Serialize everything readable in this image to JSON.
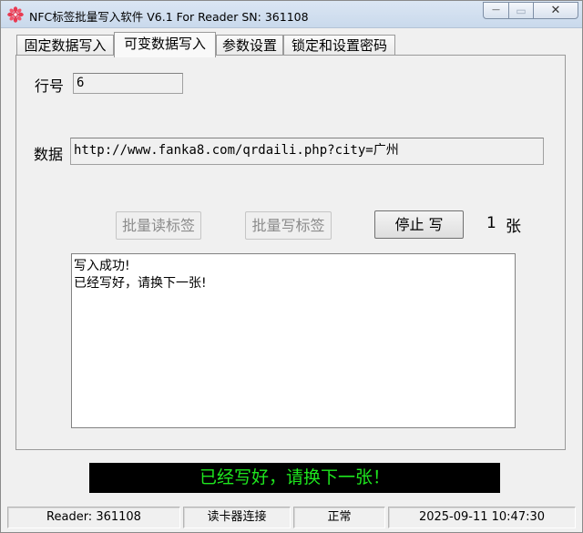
{
  "window": {
    "title": "NFC标签批量写入软件 V6.1 For Reader  SN:  361108",
    "app_icon": "gear-flower-icon",
    "controls": {
      "minimize": "—",
      "maximize": "▭",
      "close": "✕"
    }
  },
  "tabs": [
    {
      "label": "固定数据写入",
      "active": false
    },
    {
      "label": "可变数据写入",
      "active": true
    },
    {
      "label": "参数设置",
      "active": false
    },
    {
      "label": "锁定和设置密码",
      "active": false
    }
  ],
  "form": {
    "row_label": "行号",
    "row_value": "6",
    "data_label": "数据",
    "data_value": "http://www.fanka8.com/qrdaili.php?city=广州"
  },
  "buttons": {
    "batch_read": "批量读标签",
    "batch_write": "批量写标签",
    "stop_write": "停止 写"
  },
  "counter": {
    "value": "1",
    "unit": "张"
  },
  "log": {
    "lines": [
      "写入成功!",
      "已经写好，请换下一张!"
    ]
  },
  "banner": {
    "message": "已经写好，请换下一张！",
    "text_color": "#1ee61e",
    "bg_color": "#000000"
  },
  "statusbar": {
    "reader": "Reader: 361108",
    "connect": "读卡器连接",
    "state": "正常",
    "datetime": "2025-09-11 10:47:30"
  }
}
